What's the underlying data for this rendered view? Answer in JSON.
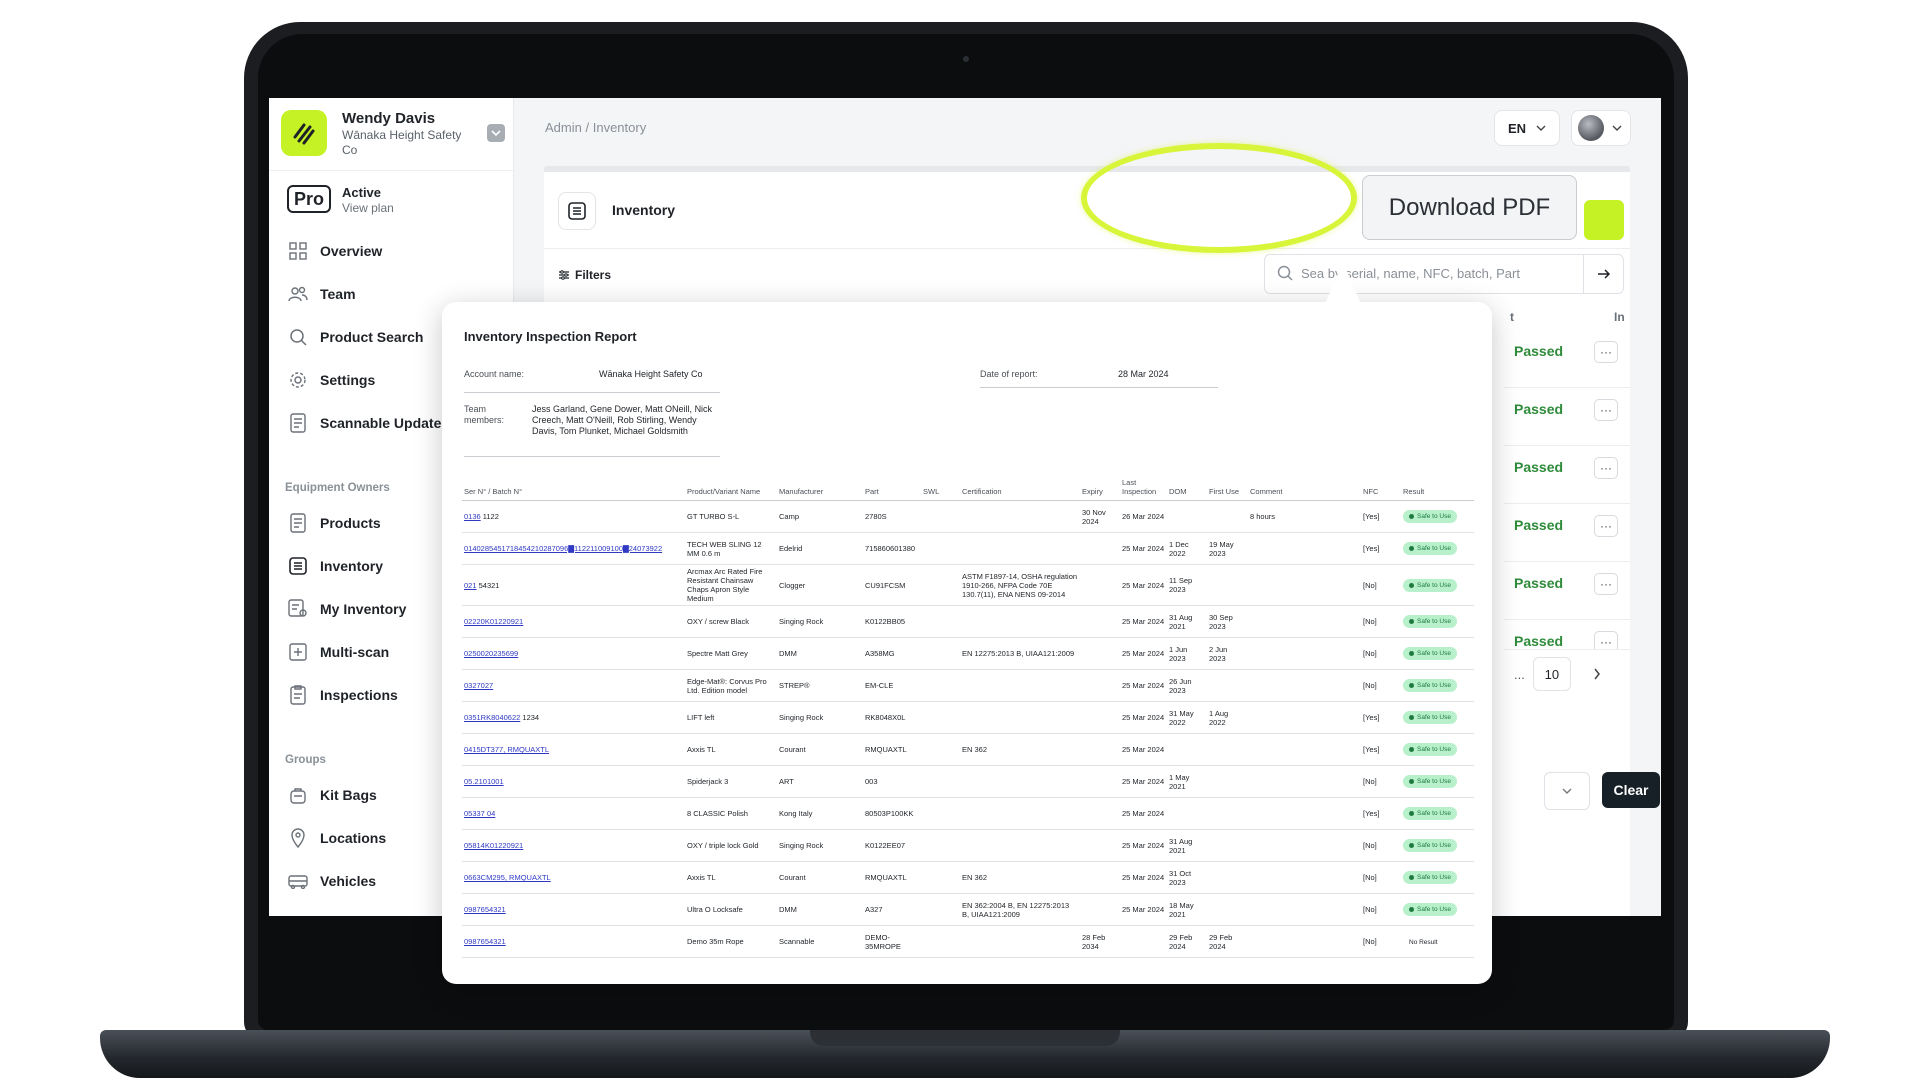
{
  "user": {
    "name": "Wendy Davis",
    "org": "Wānaka Height Safety Co"
  },
  "plan": {
    "badge": "Pro",
    "status": "Active",
    "link": "View plan"
  },
  "nav": {
    "main": [
      {
        "label": "Overview",
        "icon": "grid-icon"
      },
      {
        "label": "Team",
        "icon": "users-icon"
      },
      {
        "label": "Product Search",
        "icon": "search-icon"
      },
      {
        "label": "Settings",
        "icon": "gear-icon"
      },
      {
        "label": "Scannable Updates",
        "icon": "document-icon"
      }
    ],
    "equipment_label": "Equipment Owners",
    "equipment": [
      {
        "label": "Products",
        "icon": "document-icon"
      },
      {
        "label": "Inventory",
        "icon": "list-icon",
        "active": true
      },
      {
        "label": "My Inventory",
        "icon": "user-list-icon"
      },
      {
        "label": "Multi-scan",
        "icon": "plus-box-icon"
      },
      {
        "label": "Inspections",
        "icon": "clipboard-icon"
      }
    ],
    "groups_label": "Groups",
    "groups": [
      {
        "label": "Kit Bags",
        "icon": "bag-icon"
      },
      {
        "label": "Locations",
        "icon": "pin-icon"
      },
      {
        "label": "Vehicles",
        "icon": "vehicle-icon"
      }
    ]
  },
  "breadcrumb": {
    "root": "Admin",
    "sep": "/",
    "current": "Inventory"
  },
  "header": {
    "lang": "EN"
  },
  "card": {
    "title": "Inventory",
    "download_label": "Download PDF",
    "filters_label": "Filters",
    "search_placeholder": "Sea    by serial, name, NFC, batch, Part",
    "col_t": "t",
    "col_in": "In",
    "results": [
      "Passed",
      "Passed",
      "Passed",
      "Passed",
      "Passed",
      "Passed"
    ],
    "more_label": "···",
    "pager": {
      "ellipsis": "...",
      "last": "10"
    },
    "clear_label": "Clear"
  },
  "colors": {
    "accent": "#c5f224",
    "ring": "#d8f53a",
    "passed": "#2e8b3a",
    "safe_bg": "#b8f0cc"
  },
  "report": {
    "title": "Inventory Inspection Report",
    "account_label": "Account name:",
    "account_value": "Wānaka Height Safety Co",
    "date_label": "Date of report:",
    "date_value": "28 Mar 2024",
    "team_label": "Team members:",
    "team_value": "Jess Garland, Gene Dower, Matt ONeill, Nick Creech, Matt O'Neill, Rob Stirling, Wendy Davis, Tom Plunket, Michael Goldsmith",
    "columns": [
      "Ser N° / Batch N°",
      "Product/Variant Name",
      "Manufacturer",
      "Part",
      "SWL",
      "Certification",
      "Expiry",
      "Last Inspection",
      "DOM",
      "First Use",
      "Comment",
      "NFC",
      "Result"
    ],
    "rows": [
      {
        "serial": "0136",
        "batch": "1122",
        "product": "GT TURBO S-L",
        "mfr": "Camp",
        "part": "2780S",
        "swl": "",
        "cert": "",
        "expiry": "30 Nov 2024",
        "last": "26 Mar 2024",
        "dom": "",
        "first": "",
        "comment": "8 hours",
        "nfc": "[Yes]",
        "result": "Safe to Use"
      },
      {
        "serial": "0140285451718454210287096▇112211009100▇24073922",
        "batch": "",
        "product": "TECH WEB SLING 12 MM 0.6 m",
        "mfr": "Edelrid",
        "part": "715860601380",
        "swl": "",
        "cert": "",
        "expiry": "",
        "last": "25 Mar 2024",
        "dom": "1 Dec 2022",
        "first": "19 May 2023",
        "comment": "",
        "nfc": "[Yes]",
        "result": "Safe to Use"
      },
      {
        "serial": "021",
        "batch": "54321",
        "product": "Arcmax Arc Rated Fire Resistant Chainsaw Chaps Apron Style Medium",
        "mfr": "Clogger",
        "part": "CU91FCSM",
        "swl": "",
        "cert": "ASTM F1897-14, OSHA regulation 1910-266, NFPA Code 70E 130.7(11), ENA NENS 09-2014",
        "expiry": "",
        "last": "25 Mar 2024",
        "dom": "11 Sep 2023",
        "first": "",
        "comment": "",
        "nfc": "[No]",
        "result": "Safe to Use"
      },
      {
        "serial": "02220K01220921",
        "batch": "",
        "product": "OXY / screw Black",
        "mfr": "Singing Rock",
        "part": "K0122BB05",
        "swl": "",
        "cert": "",
        "expiry": "",
        "last": "25 Mar 2024",
        "dom": "31 Aug 2021",
        "first": "30 Sep 2023",
        "comment": "",
        "nfc": "[No]",
        "result": "Safe to Use"
      },
      {
        "serial": "0250020235699",
        "batch": "",
        "product": "Spectre Matt Grey",
        "mfr": "DMM",
        "part": "A358MG",
        "swl": "",
        "cert": "EN 12275:2013 B, UIAA121:2009",
        "expiry": "",
        "last": "25 Mar 2024",
        "dom": "1 Jun 2023",
        "first": "2 Jun 2023",
        "comment": "",
        "nfc": "[No]",
        "result": "Safe to Use"
      },
      {
        "serial": "0327027",
        "batch": "",
        "product": "Edge-Mat®: Corvus Pro Ltd. Edition model",
        "mfr": "STREP®",
        "part": "EM-CLE",
        "swl": "",
        "cert": "",
        "expiry": "",
        "last": "25 Mar 2024",
        "dom": "26 Jun 2023",
        "first": "",
        "comment": "",
        "nfc": "[No]",
        "result": "Safe to Use"
      },
      {
        "serial": "0351RK8040622",
        "batch": "1234",
        "product": "LIFT left",
        "mfr": "Singing Rock",
        "part": "RK8048X0L",
        "swl": "",
        "cert": "",
        "expiry": "",
        "last": "25 Mar 2024",
        "dom": "31 May 2022",
        "first": "1 Aug 2022",
        "comment": "",
        "nfc": "[Yes]",
        "result": "Safe to Use"
      },
      {
        "serial": "0415DT377, RMQUAXTL",
        "batch": "",
        "product": "Axxis TL",
        "mfr": "Courant",
        "part": "RMQUAXTL",
        "swl": "",
        "cert": "EN 362",
        "expiry": "",
        "last": "25 Mar 2024",
        "dom": "",
        "first": "",
        "comment": "",
        "nfc": "[Yes]",
        "result": "Safe to Use"
      },
      {
        "serial": "05.2101001",
        "batch": "",
        "product": "Spiderjack 3",
        "mfr": "ART",
        "part": "003",
        "swl": "",
        "cert": "",
        "expiry": "",
        "last": "25 Mar 2024",
        "dom": "1 May 2021",
        "first": "",
        "comment": "",
        "nfc": "[No]",
        "result": "Safe to Use"
      },
      {
        "serial": "05337 04",
        "batch": "",
        "product": "8 CLASSIC Polish",
        "mfr": "Kong Italy",
        "part": "80503P100KK",
        "swl": "",
        "cert": "",
        "expiry": "",
        "last": "25 Mar 2024",
        "dom": "",
        "first": "",
        "comment": "",
        "nfc": "[Yes]",
        "result": "Safe to Use"
      },
      {
        "serial": "05814K01220921",
        "batch": "",
        "product": "OXY / triple lock Gold",
        "mfr": "Singing Rock",
        "part": "K0122EE07",
        "swl": "",
        "cert": "",
        "expiry": "",
        "last": "25 Mar 2024",
        "dom": "31 Aug 2021",
        "first": "",
        "comment": "",
        "nfc": "[No]",
        "result": "Safe to Use"
      },
      {
        "serial": "0663CM295, RMQUAXTL",
        "batch": "",
        "product": "Axxis TL",
        "mfr": "Courant",
        "part": "RMQUAXTL",
        "swl": "",
        "cert": "EN 362",
        "expiry": "",
        "last": "25 Mar 2024",
        "dom": "31 Oct 2023",
        "first": "",
        "comment": "",
        "nfc": "[No]",
        "result": "Safe to Use"
      },
      {
        "serial": "0987654321",
        "batch": "",
        "product": "Ultra O Locksafe",
        "mfr": "DMM",
        "part": "A327",
        "swl": "",
        "cert": "EN 362:2004 B, EN 12275:2013 B, UIAA121:2009",
        "expiry": "",
        "last": "25 Mar 2024",
        "dom": "18 May 2021",
        "first": "",
        "comment": "",
        "nfc": "[No]",
        "result": "Safe to Use"
      },
      {
        "serial": "0987654321",
        "batch": "",
        "product": "Demo 35m Rope",
        "mfr": "Scannable",
        "part": "DEMO-35MROPE",
        "swl": "",
        "cert": "",
        "expiry": "28 Feb 2034",
        "last": "",
        "dom": "29 Feb 2024",
        "first": "29 Feb 2024",
        "comment": "",
        "nfc": "[No]",
        "result": "No Result"
      }
    ]
  }
}
